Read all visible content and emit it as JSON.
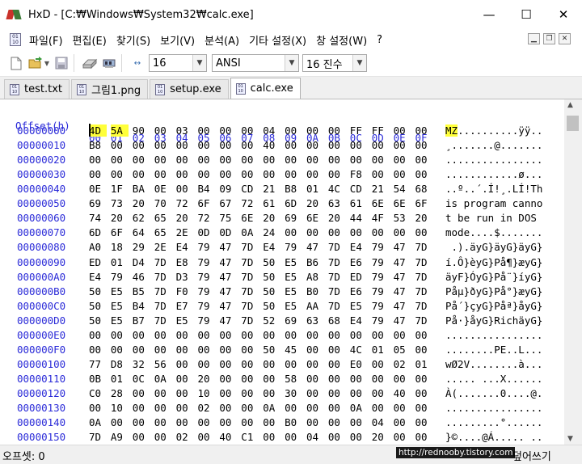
{
  "window": {
    "title": "HxD - [C:₩Windows₩System32₩calc.exe]",
    "controls": [
      "—",
      "☐",
      "✕"
    ]
  },
  "menu": {
    "items": [
      "파일(F)",
      "편집(E)",
      "찾기(S)",
      "보기(V)",
      "분석(A)",
      "기타 설정(X)",
      "창 설정(W)",
      "?"
    ]
  },
  "toolbar": {
    "bytes_per_row": "16",
    "charset": "ANSI",
    "offset_base": "16 진수"
  },
  "tabs": [
    {
      "label": "test.txt",
      "active": false
    },
    {
      "label": "그림1.png",
      "active": false
    },
    {
      "label": "setup.exe",
      "active": false
    },
    {
      "label": "calc.exe",
      "active": true
    }
  ],
  "hex": {
    "header_label": "Offset(h)",
    "columns": [
      "00",
      "01",
      "02",
      "03",
      "04",
      "05",
      "06",
      "07",
      "08",
      "09",
      "0A",
      "0B",
      "0C",
      "0D",
      "0E",
      "0F"
    ],
    "highlight_color": "#ffff3a",
    "rows": [
      {
        "offset": "00000000",
        "bytes": [
          "4D",
          "5A",
          "90",
          "00",
          "03",
          "00",
          "00",
          "00",
          "04",
          "00",
          "00",
          "00",
          "FF",
          "FF",
          "00",
          "00"
        ],
        "ascii": "MZ..........ÿÿ.."
      },
      {
        "offset": "00000010",
        "bytes": [
          "B8",
          "00",
          "00",
          "00",
          "00",
          "00",
          "00",
          "00",
          "40",
          "00",
          "00",
          "00",
          "00",
          "00",
          "00",
          "00"
        ],
        "ascii": "¸.......@......."
      },
      {
        "offset": "00000020",
        "bytes": [
          "00",
          "00",
          "00",
          "00",
          "00",
          "00",
          "00",
          "00",
          "00",
          "00",
          "00",
          "00",
          "00",
          "00",
          "00",
          "00"
        ],
        "ascii": "................"
      },
      {
        "offset": "00000030",
        "bytes": [
          "00",
          "00",
          "00",
          "00",
          "00",
          "00",
          "00",
          "00",
          "00",
          "00",
          "00",
          "00",
          "F8",
          "00",
          "00",
          "00"
        ],
        "ascii": "............ø..."
      },
      {
        "offset": "00000040",
        "bytes": [
          "0E",
          "1F",
          "BA",
          "0E",
          "00",
          "B4",
          "09",
          "CD",
          "21",
          "B8",
          "01",
          "4C",
          "CD",
          "21",
          "54",
          "68"
        ],
        "ascii": "..º..´.Í!¸.LÍ!Th"
      },
      {
        "offset": "00000050",
        "bytes": [
          "69",
          "73",
          "20",
          "70",
          "72",
          "6F",
          "67",
          "72",
          "61",
          "6D",
          "20",
          "63",
          "61",
          "6E",
          "6E",
          "6F"
        ],
        "ascii": "is program canno"
      },
      {
        "offset": "00000060",
        "bytes": [
          "74",
          "20",
          "62",
          "65",
          "20",
          "72",
          "75",
          "6E",
          "20",
          "69",
          "6E",
          "20",
          "44",
          "4F",
          "53",
          "20"
        ],
        "ascii": "t be run in DOS "
      },
      {
        "offset": "00000070",
        "bytes": [
          "6D",
          "6F",
          "64",
          "65",
          "2E",
          "0D",
          "0D",
          "0A",
          "24",
          "00",
          "00",
          "00",
          "00",
          "00",
          "00",
          "00"
        ],
        "ascii": "mode....$......."
      },
      {
        "offset": "00000080",
        "bytes": [
          "A0",
          "18",
          "29",
          "2E",
          "E4",
          "79",
          "47",
          "7D",
          "E4",
          "79",
          "47",
          "7D",
          "E4",
          "79",
          "47",
          "7D"
        ],
        "ascii": " .).äyG}äyG}äyG}"
      },
      {
        "offset": "00000090",
        "bytes": [
          "ED",
          "01",
          "D4",
          "7D",
          "E8",
          "79",
          "47",
          "7D",
          "50",
          "E5",
          "B6",
          "7D",
          "E6",
          "79",
          "47",
          "7D"
        ],
        "ascii": "í.Ô}èyG}På¶}æyG}"
      },
      {
        "offset": "000000A0",
        "bytes": [
          "E4",
          "79",
          "46",
          "7D",
          "D3",
          "79",
          "47",
          "7D",
          "50",
          "E5",
          "A8",
          "7D",
          "ED",
          "79",
          "47",
          "7D"
        ],
        "ascii": "äyF}ÓyG}På¨}íyG}"
      },
      {
        "offset": "000000B0",
        "bytes": [
          "50",
          "E5",
          "B5",
          "7D",
          "F0",
          "79",
          "47",
          "7D",
          "50",
          "E5",
          "B0",
          "7D",
          "E6",
          "79",
          "47",
          "7D"
        ],
        "ascii": "Påµ}ðyG}På°}æyG}"
      },
      {
        "offset": "000000C0",
        "bytes": [
          "50",
          "E5",
          "B4",
          "7D",
          "E7",
          "79",
          "47",
          "7D",
          "50",
          "E5",
          "AA",
          "7D",
          "E5",
          "79",
          "47",
          "7D"
        ],
        "ascii": "På´}çyG}Påª}åyG}"
      },
      {
        "offset": "000000D0",
        "bytes": [
          "50",
          "E5",
          "B7",
          "7D",
          "E5",
          "79",
          "47",
          "7D",
          "52",
          "69",
          "63",
          "68",
          "E4",
          "79",
          "47",
          "7D"
        ],
        "ascii": "På·}åyG}RichäyG}"
      },
      {
        "offset": "000000E0",
        "bytes": [
          "00",
          "00",
          "00",
          "00",
          "00",
          "00",
          "00",
          "00",
          "00",
          "00",
          "00",
          "00",
          "00",
          "00",
          "00",
          "00"
        ],
        "ascii": "................"
      },
      {
        "offset": "000000F0",
        "bytes": [
          "00",
          "00",
          "00",
          "00",
          "00",
          "00",
          "00",
          "00",
          "50",
          "45",
          "00",
          "00",
          "4C",
          "01",
          "05",
          "00"
        ],
        "ascii": "........PE..L..."
      },
      {
        "offset": "00000100",
        "bytes": [
          "77",
          "D8",
          "32",
          "56",
          "00",
          "00",
          "00",
          "00",
          "00",
          "00",
          "00",
          "00",
          "E0",
          "00",
          "02",
          "01"
        ],
        "ascii": "wØ2V........à..."
      },
      {
        "offset": "00000110",
        "bytes": [
          "0B",
          "01",
          "0C",
          "0A",
          "00",
          "20",
          "00",
          "00",
          "00",
          "58",
          "00",
          "00",
          "00",
          "00",
          "00",
          "00"
        ],
        "ascii": "..... ...X......"
      },
      {
        "offset": "00000120",
        "bytes": [
          "C0",
          "28",
          "00",
          "00",
          "00",
          "10",
          "00",
          "00",
          "00",
          "30",
          "00",
          "00",
          "00",
          "00",
          "40",
          "00"
        ],
        "ascii": "À(.......0....@."
      },
      {
        "offset": "00000130",
        "bytes": [
          "00",
          "10",
          "00",
          "00",
          "00",
          "02",
          "00",
          "00",
          "0A",
          "00",
          "00",
          "00",
          "0A",
          "00",
          "00",
          "00"
        ],
        "ascii": "................"
      },
      {
        "offset": "00000140",
        "bytes": [
          "0A",
          "00",
          "00",
          "00",
          "00",
          "00",
          "00",
          "00",
          "00",
          "B0",
          "00",
          "00",
          "00",
          "04",
          "00",
          "00"
        ],
        "ascii": ".........°......"
      },
      {
        "offset": "00000150",
        "bytes": [
          "7D",
          "A9",
          "00",
          "00",
          "02",
          "00",
          "40",
          "C1",
          "00",
          "00",
          "04",
          "00",
          "00",
          "20",
          "00",
          "00"
        ],
        "ascii": "}©....@Á..... .."
      }
    ]
  },
  "status": {
    "offset": "오프셋: 0",
    "watermark": "http://rednooby.tistory.com",
    "mode": "덮어쓰기"
  }
}
